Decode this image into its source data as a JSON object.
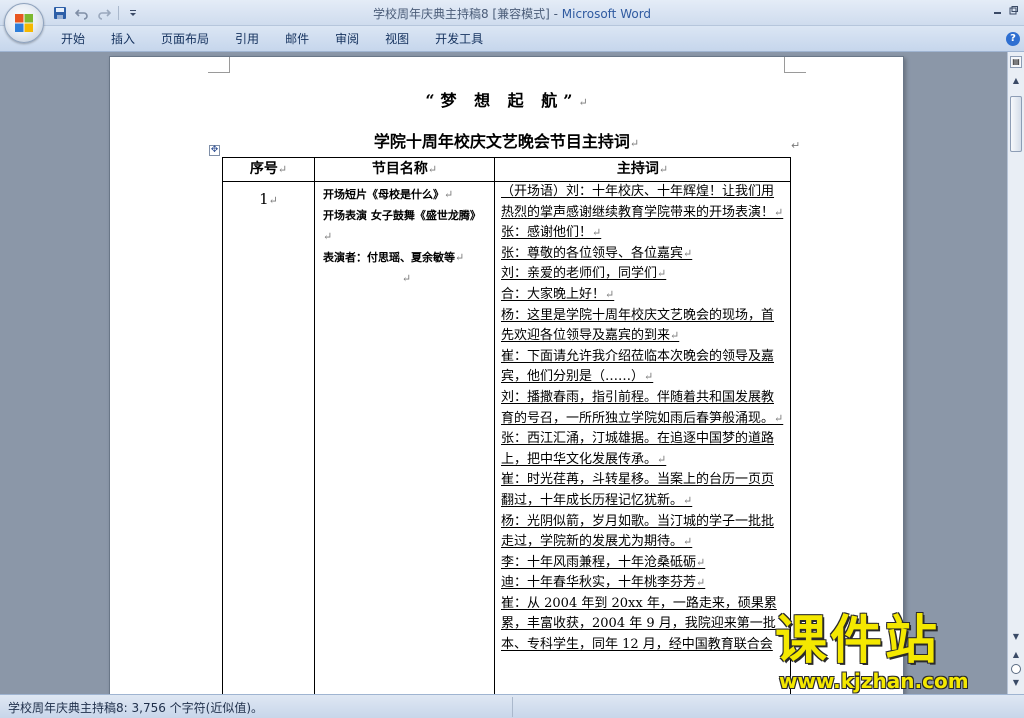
{
  "window": {
    "doc_name": "学校周年庆典主持稿8",
    "mode": "[兼容模式]",
    "separator": " - ",
    "app_name": "Microsoft Word"
  },
  "ribbon": {
    "tabs": [
      "开始",
      "插入",
      "页面布局",
      "引用",
      "邮件",
      "审阅",
      "视图",
      "开发工具"
    ],
    "help": "?"
  },
  "document": {
    "title1": "“梦 想 起 航”",
    "title2": "学院十周年校庆文艺晚会节目主持词",
    "paragraph_mark": "↵",
    "table": {
      "headers": [
        "序号",
        "节目名称",
        "主持词"
      ],
      "row": {
        "number": "1",
        "program_lines": [
          "开场短片《母校是什么》",
          "开场表演 女子鼓舞《盛世龙腾》",
          "表演者：付思瑶、夏余敏等"
        ],
        "host_lines": [
          "（开场语）刘：十年校庆、十年辉煌！让我们用热烈的掌声感谢继续教育学院带来的开场表演！",
          "张：感谢他们！",
          "张：尊敬的各位领导、各位嘉宾",
          "刘：亲爱的老师们，同学们",
          "合：大家晚上好！",
          "杨：这里是学院十周年校庆文艺晚会的现场，首先欢迎各位领导及嘉宾的到来",
          "崔：下面请允许我介绍莅临本次晚会的领导及嘉宾，他们分别是（……）",
          "刘：播撒春雨，指引前程。伴随着共和国发展教育的号召，一所所独立学院如雨后春笋般涌现。",
          "张：西江汇涌，汀城雄据。在追逐中国梦的道路上，把中华文化发展传承。",
          "崔：时光荏苒，斗转星移。当案上的台历一页页翻过，十年成长历程记忆犹新。",
          "杨：光阴似箭，岁月如歌。当汀城的学子一批批走过，学院新的发展尤为期待。",
          "李：十年风雨兼程，十年沧桑砥砺",
          "迪：十年春华秋实，十年桃李芬芳",
          "崔：从 2004 年到 20xx 年，一路走来，硕果累累，丰富收获，2004 年 9 月，我院迎来第一批本、专科学生，同年 12 月，经中国教育联合会"
        ]
      }
    }
  },
  "status": {
    "text": "学校周年庆典主持稿8: 3,756 个字符(近似值)。"
  },
  "watermark": {
    "cn": "课件站",
    "url": "www.kjzhan.com"
  },
  "icons": [
    "office-button-icon",
    "save-icon",
    "undo-icon",
    "redo-icon",
    "customize-qat-icon",
    "minimize-icon",
    "restore-icon",
    "help-icon",
    "table-move-handle-icon",
    "ruler-toggle-icon",
    "scroll-up-icon",
    "scroll-down-icon",
    "previous-page-icon",
    "browse-object-icon",
    "next-page-icon"
  ]
}
